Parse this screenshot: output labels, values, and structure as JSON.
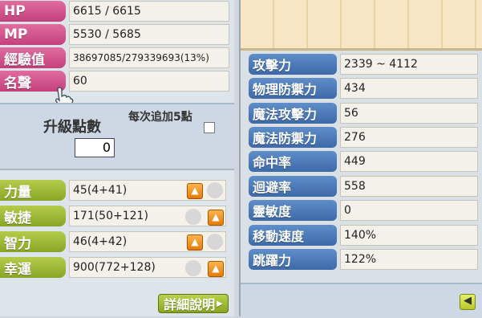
{
  "basic": {
    "hp": {
      "label": "HP",
      "value": "6615 / 6615"
    },
    "mp": {
      "label": "MP",
      "value": "5530 / 5685"
    },
    "exp": {
      "label": "經驗值",
      "value": "38697085/279339693(13%)"
    },
    "fame": {
      "label": "名聲",
      "value": "60"
    }
  },
  "levelup": {
    "points_label": "升級點數",
    "points_value": "0",
    "per_add_label": "每次追加5點"
  },
  "stats": [
    {
      "label": "力量",
      "value": "45(4+41)"
    },
    {
      "label": "敏捷",
      "value": "171(50+121)"
    },
    {
      "label": "智力",
      "value": "46(4+42)"
    },
    {
      "label": "幸運",
      "value": "900(772+128)"
    }
  ],
  "detail_button": "詳細說明",
  "detailed": [
    {
      "label": "攻擊力",
      "value": "2339 ~ 4112"
    },
    {
      "label": "物理防禦力",
      "value": "434"
    },
    {
      "label": "魔法攻擊力",
      "value": "56"
    },
    {
      "label": "魔法防禦力",
      "value": "276"
    },
    {
      "label": "命中率",
      "value": "449"
    },
    {
      "label": "迴避率",
      "value": "558"
    },
    {
      "label": "靈敏度",
      "value": "0"
    },
    {
      "label": "移動速度",
      "value": "140%"
    },
    {
      "label": "跳躍力",
      "value": "122%"
    }
  ],
  "colors": {
    "pink_label": "#d9558f",
    "green_label": "#9fba38",
    "blue_label": "#4f7cb8",
    "up_button": "#f59a22"
  }
}
